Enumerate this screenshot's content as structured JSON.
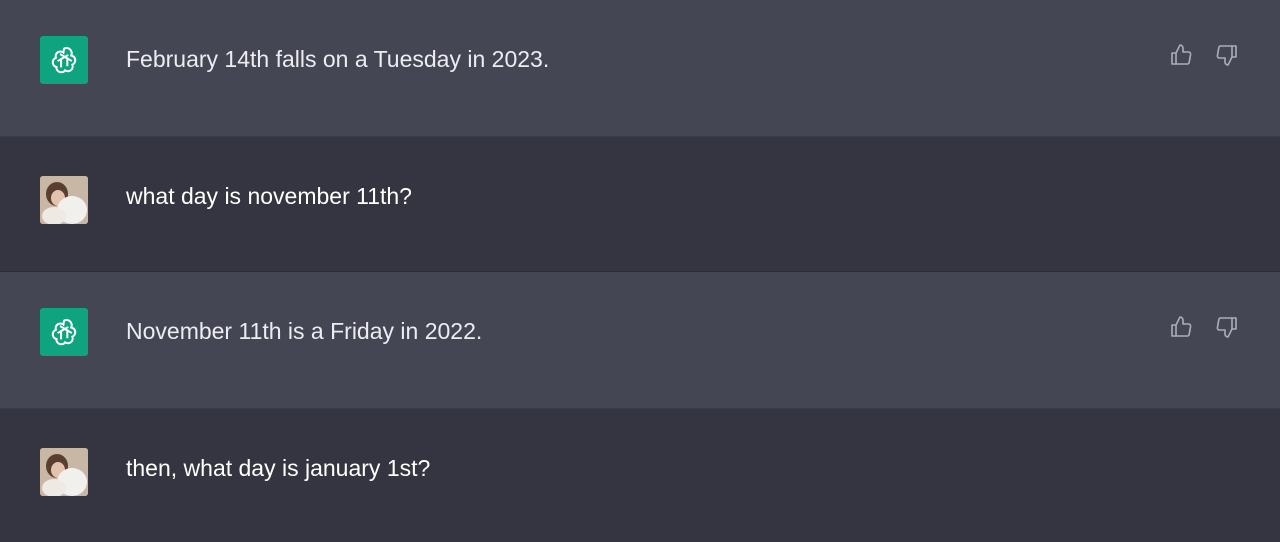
{
  "conversation": [
    {
      "role": "assistant",
      "text": "February 14th falls on a Tuesday in 2023."
    },
    {
      "role": "user",
      "text": "what day is november 11th?"
    },
    {
      "role": "assistant",
      "text": "November 11th is a Friday in 2022."
    },
    {
      "role": "user",
      "text": "then, what day is january 1st?"
    }
  ],
  "icons": {
    "assistant_avatar": "openai-logo-icon",
    "user_avatar": "user-photo-avatar",
    "thumbs_up": "thumbs-up-icon",
    "thumbs_down": "thumbs-down-icon"
  },
  "colors": {
    "assistant_bg": "#444654",
    "user_bg": "#343541",
    "avatar_green": "#10a37f",
    "text": "#ececf1"
  }
}
